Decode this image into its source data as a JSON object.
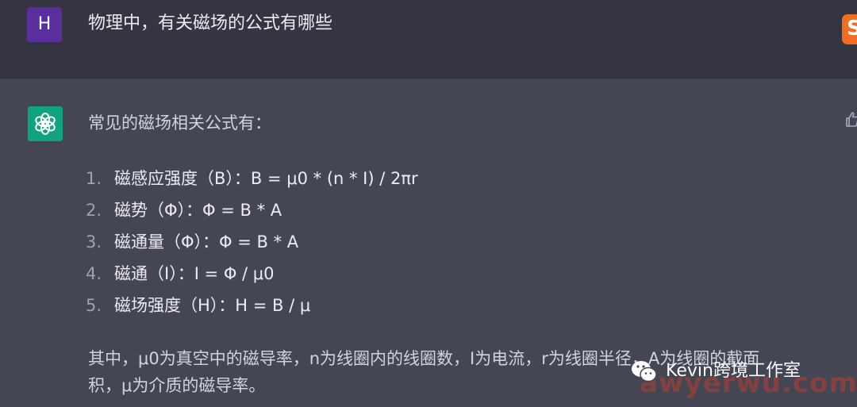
{
  "user": {
    "avatar_letter": "H",
    "message": "物理中，有关磁场的公式有哪些"
  },
  "assistant": {
    "intro": "常见的磁场相关公式有：",
    "formulas": [
      {
        "num": "1.",
        "text": "磁感应强度（B）：B = μ0 * (n * I) / 2πr"
      },
      {
        "num": "2.",
        "text": "磁势（Φ）：Φ = B * A"
      },
      {
        "num": "3.",
        "text": "磁通量（Φ）：Φ = B * A"
      },
      {
        "num": "4.",
        "text": "磁通（I）：I = Φ / μ0"
      },
      {
        "num": "5.",
        "text": "磁场强度（H）：H = B / μ"
      }
    ],
    "note_line1": "其中，μ0为真空中的磁导率，n为线圈内的线圈数，I为电流，r为线圈半径，A为线圈的截面",
    "note_line2": "积，μ为介质的磁导率。"
  },
  "overlay": {
    "wechat_watermark": "Kevin跨境工作室",
    "site_watermark": "awyerwu.com"
  },
  "colors": {
    "user_bg": "#343541",
    "assistant_bg": "#444654",
    "user_avatar": "#5b2e9e",
    "gpt_avatar": "#10a37f",
    "edit_logo": "#f26d21"
  },
  "icons": [
    "openai-logo-icon",
    "thumbs-up-icon",
    "wechat-icon",
    "edit-logo-icon"
  ]
}
